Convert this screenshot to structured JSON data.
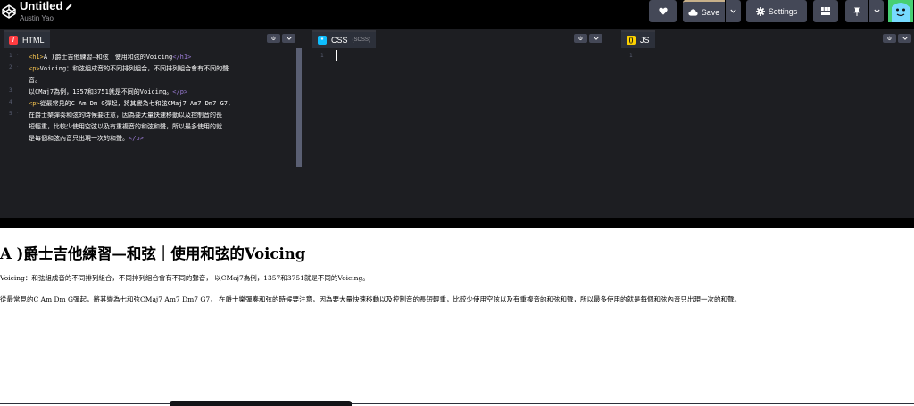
{
  "header": {
    "title": "Untitled",
    "author": "Austin Yao",
    "save_label": "Save",
    "settings_label": "Settings",
    "icons": [
      "codepen-logo-icon",
      "pencil-icon",
      "heart-icon",
      "cloud-icon",
      "chevron-down-icon",
      "gear-icon",
      "layout-icon",
      "pin-icon",
      "avatar"
    ]
  },
  "editors": {
    "html": {
      "label": "HTML",
      "icon_color": "#ff3c41",
      "line_numbers": [
        "1",
        "2",
        "3",
        "4",
        "5"
      ],
      "lines": [
        {
          "open": "<h1>",
          "text": "A )爵士吉他練習—和弦｜使用和弦的Voicing",
          "close": "</h1>"
        },
        {
          "open": "<p>",
          "text": "Voicing：和弦組成音的不同排列組合，不同排列組合會有不同的聲",
          "close": ""
        },
        {
          "open": "",
          "text": "音。",
          "close": ""
        },
        {
          "open": "",
          "text": "以CMaj7為例，1357和3751就是不同的Voicing。",
          "close": "</p>"
        },
        {
          "open": "<p>",
          "text": "從最常見的C Am Dm G彈起，將其變為七和弦CMaj7 Am7 Dm7 G7，",
          "close": ""
        },
        {
          "open": "",
          "text": "在爵士樂彈奏和弦的時候要注意，因為要大量快速移動以及控制音的長",
          "close": ""
        },
        {
          "open": "",
          "text": "短輕重，比較少使用空弦以及有重複音的和弦和聲，所以最多使用的就",
          "close": ""
        },
        {
          "open": "",
          "text": "是每個和弦內音只出現一次的和聲。",
          "close": "</p>"
        }
      ]
    },
    "css": {
      "label": "CSS",
      "sub": "(SCSS)",
      "icon_color": "#0ebeff",
      "line_numbers": [
        "1"
      ]
    },
    "js": {
      "label": "JS",
      "icon_color": "#fcd000",
      "line_numbers": [
        "1"
      ]
    }
  },
  "preview": {
    "h1": "A )爵士吉他練習—和弦｜使用和弦的Voicing",
    "p1": "Voicing：和弦組成音的不同排列組合，不同排列組合會有不同的聲音， 以CMaj7為例，1357和3751就是不同的Voicing。",
    "p2": "從最常見的C Am Dm G彈起，將其變為七和弦CMaj7 Am7 Dm7 G7， 在爵士樂彈奏和弦的時候要注意，因為要大量快速移動以及控制音的長短輕重，比較少使用空弦以及有重複音的和弦和聲，所以最多使用的就是每個和弦內音只出現一次的和聲。"
  }
}
